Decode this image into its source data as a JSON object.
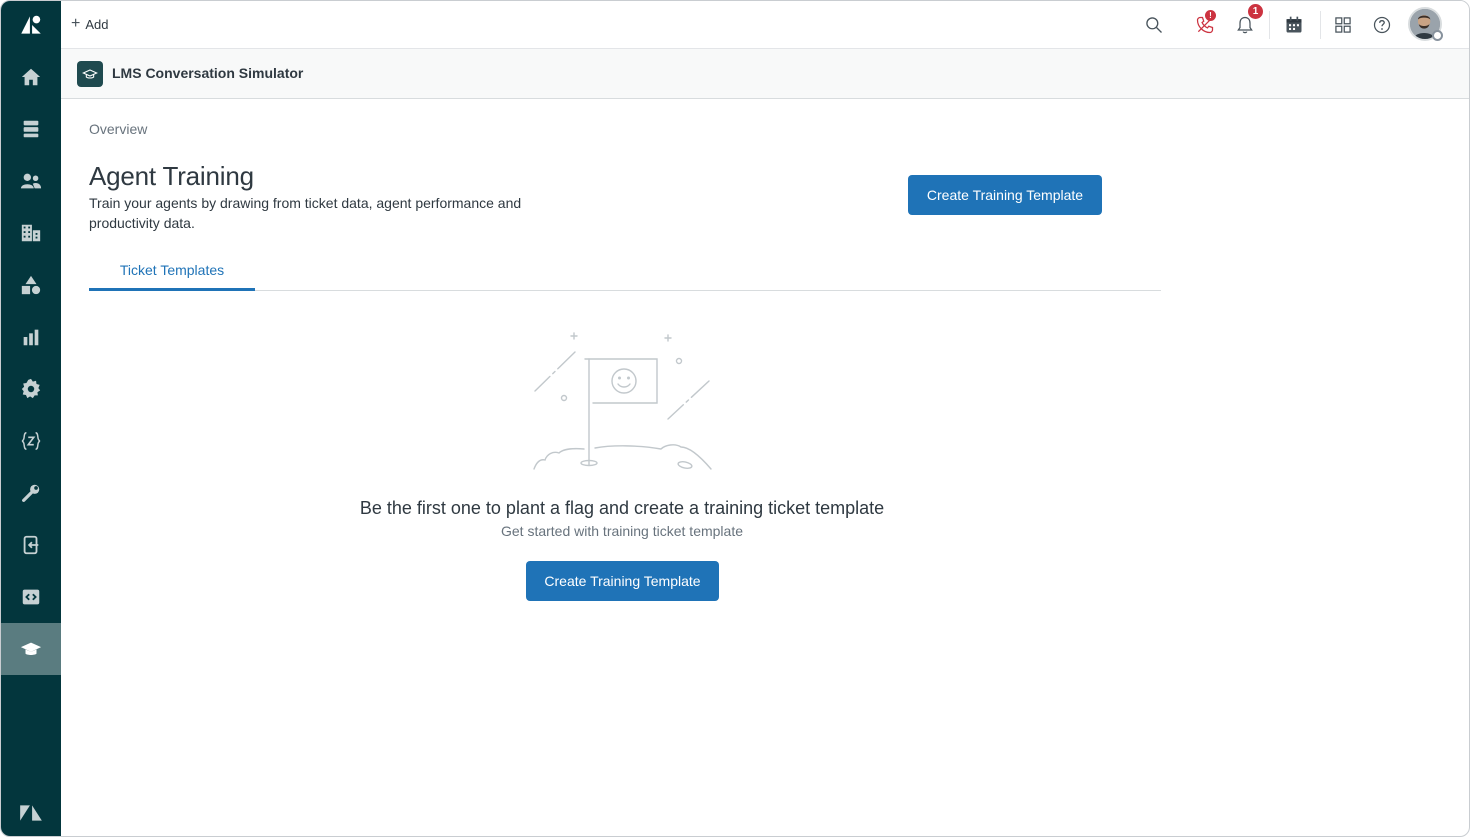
{
  "topbar": {
    "add_label": "Add",
    "phone_badge": "!",
    "notifications_badge": "1"
  },
  "sidebar": {
    "items": [
      {
        "name": "home",
        "icon": "home-icon"
      },
      {
        "name": "views",
        "icon": "views-icon"
      },
      {
        "name": "customers",
        "icon": "users-icon"
      },
      {
        "name": "organizations",
        "icon": "building-icon"
      },
      {
        "name": "objects",
        "icon": "shapes-icon"
      },
      {
        "name": "reporting",
        "icon": "bar-chart-icon"
      },
      {
        "name": "admin",
        "icon": "gear-icon"
      },
      {
        "name": "sunshine",
        "icon": "curly-z-icon"
      },
      {
        "name": "tools",
        "icon": "wrench-icon"
      },
      {
        "name": "export",
        "icon": "export-icon"
      },
      {
        "name": "code",
        "icon": "code-icon"
      },
      {
        "name": "training",
        "icon": "graduation-cap-icon",
        "active": true
      }
    ]
  },
  "app": {
    "title": "LMS Conversation Simulator"
  },
  "page": {
    "breadcrumb": "Overview",
    "title": "Agent Training",
    "description": "Train your agents by drawing from ticket data, agent performance and productivity data.",
    "create_button": "Create Training Template"
  },
  "tabs": [
    {
      "label": "Ticket Templates",
      "active": true
    }
  ],
  "empty_state": {
    "title": "Be the first one to plant a flag and create a training ticket template",
    "subtitle": "Get started with training ticket template",
    "button": "Create Training Template"
  },
  "colors": {
    "sidebar_bg": "#03363d",
    "primary": "#1f73b7",
    "badge": "#cc3340"
  }
}
